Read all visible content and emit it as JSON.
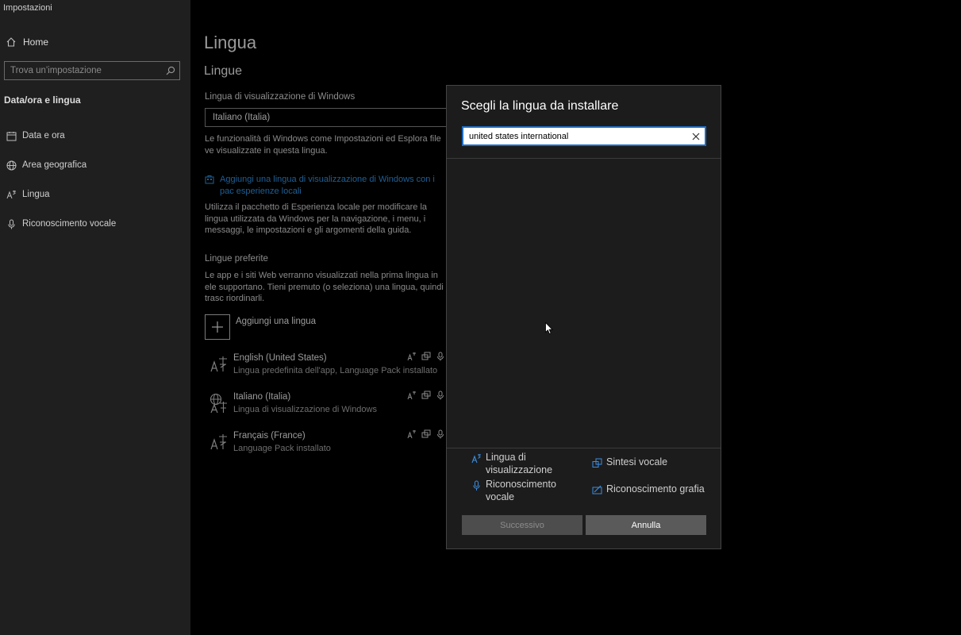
{
  "window": {
    "title": "Impostazioni"
  },
  "sidebar": {
    "home_label": "Home",
    "search_placeholder": "Trova un'impostazione",
    "section_title": "Data/ora e lingua",
    "items": [
      {
        "label": "Data e ora",
        "icon": "clock-icon"
      },
      {
        "label": "Area geografica",
        "icon": "globe-icon"
      },
      {
        "label": "Lingua",
        "icon": "language-icon"
      },
      {
        "label": "Riconoscimento vocale",
        "icon": "microphone-icon"
      }
    ]
  },
  "main": {
    "title": "Lingua",
    "subtitle": "Lingue",
    "display_language_label": "Lingua di visualizzazione di Windows",
    "display_language_value": "Italiano (Italia)",
    "display_desc": "Le funzionalità di Windows come Impostazioni ed Esplora file ve visualizzate in questa lingua.",
    "link_text": "Aggiungi una lingua di visualizzazione di Windows con i pac esperienze locali",
    "experience_desc": "Utilizza il pacchetto di Esperienza locale per modificare la lingua utilizzata da Windows per la navigazione, i menu, i messaggi, le impostazioni e gli argomenti della guida.",
    "preferred_label": "Lingue preferite",
    "preferred_desc": "Le app e i siti Web verranno visualizzati nella prima lingua in ele supportano. Tieni premuto (o seleziona) una lingua, quindi trasc riordinarli.",
    "add_language_label": "Aggiungi una lingua",
    "languages": [
      {
        "name": "English (United States)",
        "desc": "Lingua predefinita dell'app, Language Pack installato"
      },
      {
        "name": "Italiano (Italia)",
        "desc": "Lingua di visualizzazione di Windows"
      },
      {
        "name": "Français (France)",
        "desc": "Language Pack installato"
      }
    ]
  },
  "dialog": {
    "title": "Scegli la lingua da installare",
    "search_value": "united states international",
    "legend": {
      "display_language": "Lingua di visualizzazione",
      "speech_synthesis": "Sintesi vocale",
      "speech_recognition": "Riconoscimento vocale",
      "handwriting": "Riconoscimento grafia"
    },
    "next_label": "Successivo",
    "cancel_label": "Annulla"
  },
  "colors": {
    "accent": "#1f6dc4",
    "link": "#1f5f96",
    "sidebar_bg": "#1f1f1f",
    "dialog_bg": "#1c1c1c"
  }
}
